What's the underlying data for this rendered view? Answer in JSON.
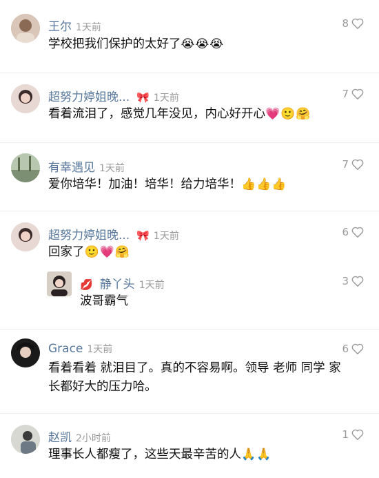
{
  "comments": [
    {
      "name": "王尔",
      "time": "1天前",
      "likes": "8",
      "text": "学校把我们保护的太好了",
      "emoji": "😭😭😭"
    },
    {
      "name": "超努力婷姐晚...",
      "badge": "🎀",
      "time": "1天前",
      "likes": "7",
      "text": "看着流泪了，感觉几年没见，内心好开心",
      "emoji": "💗🙂🤗"
    },
    {
      "name": "有幸遇见",
      "time": "1天前",
      "likes": "7",
      "text": "爱你培华！加油！培华！给力培华！",
      "emoji": "👍👍👍"
    },
    {
      "name": "超努力婷姐晚...",
      "badge": "🎀",
      "time": "1天前",
      "likes": "6",
      "text": "回家了",
      "emoji": "🙂💗🤗",
      "reply": {
        "name": "静丫头",
        "lips": "💋",
        "time": "1天前",
        "likes": "3",
        "text": "波哥霸气"
      }
    },
    {
      "name": "Grace",
      "time": "1天前",
      "likes": "6",
      "text_line1": "看着看着 就泪目了。真的不容易啊。领导 老师 同学 家",
      "text_line2": "长都好大的压力哈。"
    },
    {
      "name": "赵凯",
      "time": "2小时前",
      "likes": "1",
      "text": "理事长人都瘦了，这些天最辛苦的人",
      "emoji": "🙏🙏"
    }
  ],
  "colors": {
    "name": "#57779b",
    "meta": "#9a9a9a",
    "text": "#111111"
  }
}
